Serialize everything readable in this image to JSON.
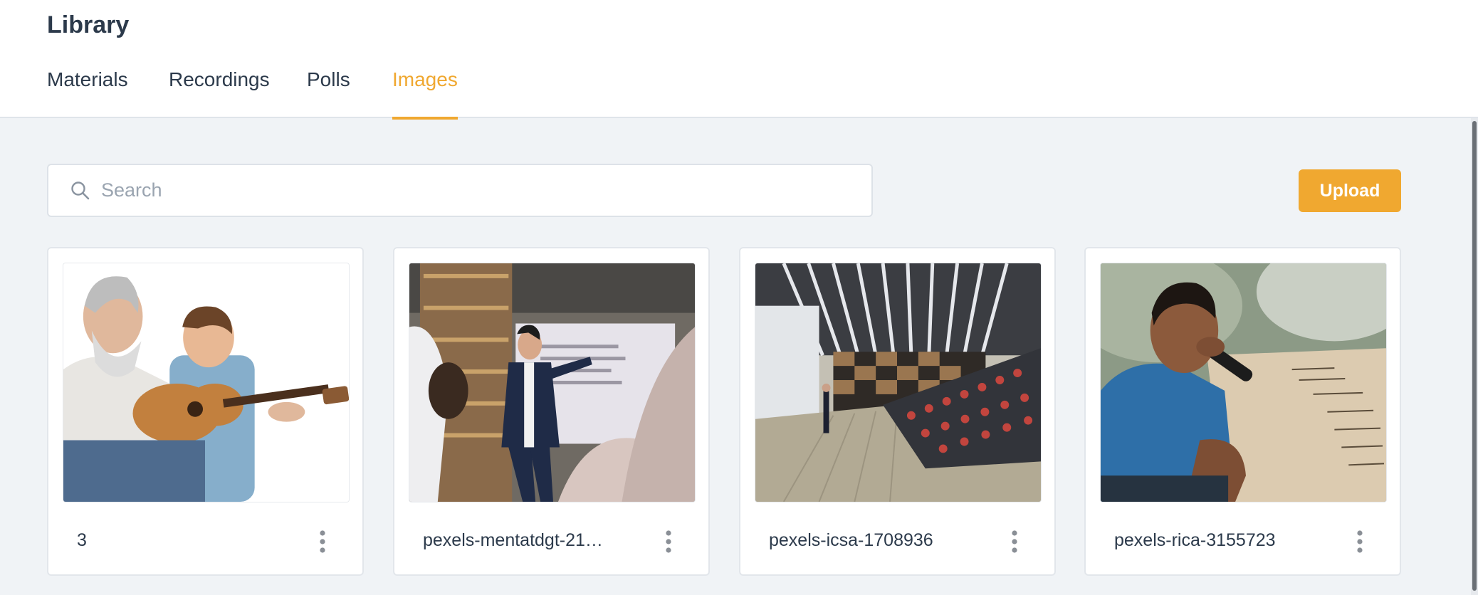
{
  "header": {
    "title": "Library"
  },
  "tabs": [
    {
      "label": "Materials",
      "active": false
    },
    {
      "label": "Recordings",
      "active": false
    },
    {
      "label": "Polls",
      "active": false
    },
    {
      "label": "Images",
      "active": true
    }
  ],
  "search": {
    "placeholder": "Search",
    "value": "",
    "icon": "search-icon"
  },
  "upload": {
    "label": "Upload"
  },
  "cards": [
    {
      "name": "3",
      "menu_icon": "more-vertical-icon"
    },
    {
      "name": "pexels-mentatdgt-21…",
      "menu_icon": "more-vertical-icon"
    },
    {
      "name": "pexels-icsa-1708936",
      "menu_icon": "more-vertical-icon"
    },
    {
      "name": "pexels-rica-3155723",
      "menu_icon": "more-vertical-icon"
    }
  ],
  "colors": {
    "accent": "#f0a830",
    "text": "#2c3a4b",
    "background": "#f0f3f6",
    "surface": "#ffffff"
  }
}
